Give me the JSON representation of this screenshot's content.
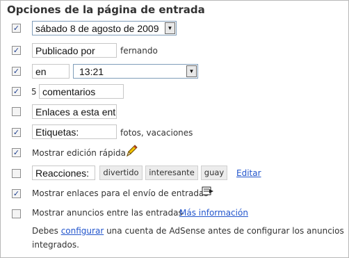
{
  "title": "Opciones de la página de entrada",
  "date_select": "sábado 8 de agosto de 2009",
  "posted_by": {
    "checked": true,
    "field": "Publicado por",
    "author": "fernando"
  },
  "time": {
    "checked": true,
    "field": "en",
    "value": "13:21"
  },
  "comments": {
    "checked": true,
    "count": "5",
    "field": "comentarios"
  },
  "backlinks": {
    "checked": false,
    "field": "Enlaces a esta entr"
  },
  "labels": {
    "checked": true,
    "field": "Etiquetas:",
    "values": "fotos, vacaciones"
  },
  "quick_edit": {
    "checked": true,
    "label": "Mostrar edición rápida",
    "icon": "pencil-icon"
  },
  "reactions": {
    "checked": false,
    "field": "Reacciones:",
    "buttons": [
      "divertido",
      "interesante",
      "guay"
    ],
    "edit": "Editar"
  },
  "email_links": {
    "checked": true,
    "label": "Mostrar enlaces para el envío de entradas",
    "icon": "email-post-icon"
  },
  "ads": {
    "checked": false,
    "label": "Mostrar anuncios entre las entradas",
    "more_info": "Más información"
  },
  "note": {
    "prefix": "Debes",
    "link": "configurar",
    "suffix_line1": "una cuenta de AdSense antes de configurar los anuncios",
    "line2": "integrados."
  },
  "colors": {
    "link": "#2255cc",
    "check": "#1f3f8f",
    "border": "#b8b8b8"
  }
}
